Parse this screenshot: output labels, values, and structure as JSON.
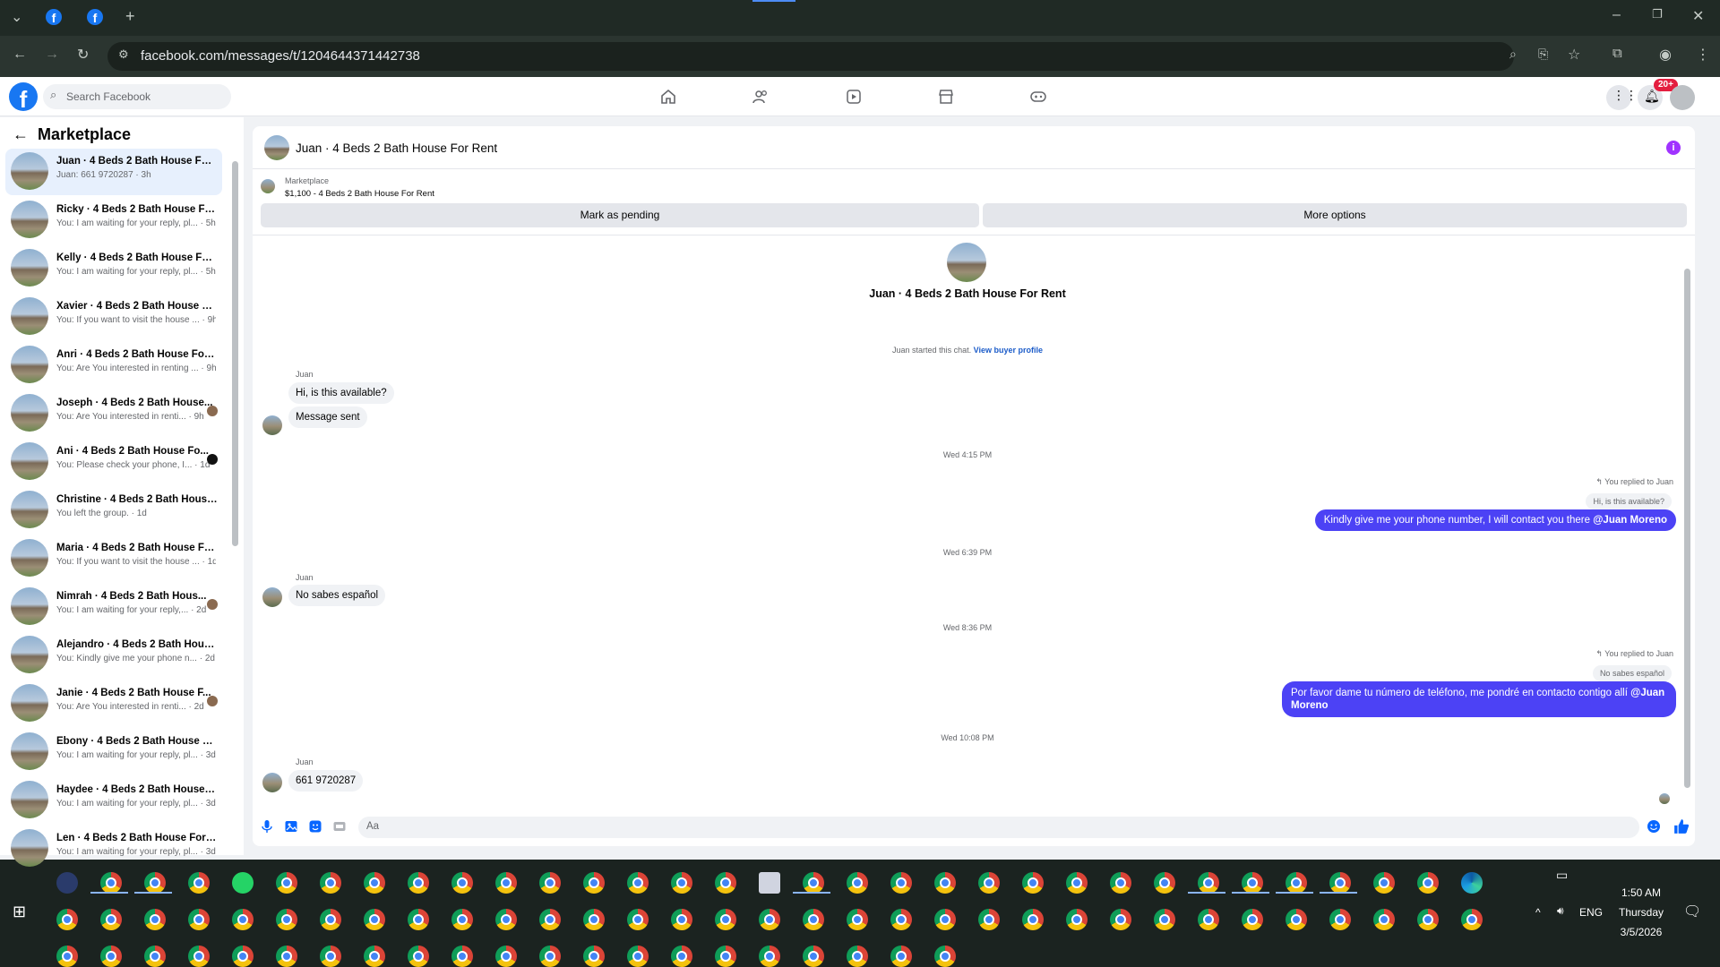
{
  "browser": {
    "url": "facebook.com/messages/t/1204644371442738",
    "new_tab_symbol": "+"
  },
  "fb": {
    "logo": "f",
    "search_placeholder": "Search Facebook",
    "notification_count": "20+",
    "nav_icons": [
      "home-icon",
      "friends-icon",
      "video-icon",
      "marketplace-icon",
      "gaming-icon"
    ]
  },
  "sidebar": {
    "title": "Marketplace",
    "back_symbol": "←",
    "conversations": [
      {
        "name": "Juan · 4 Beds 2 Bath House For ...",
        "snippet": "Juan: 661 9720287 · 3h",
        "active": true
      },
      {
        "name": "Ricky · 4 Beds 2 Bath House For...",
        "snippet": "You: I am waiting for your reply, pl... · 5h"
      },
      {
        "name": "Kelly · 4 Beds 2 Bath House For ...",
        "snippet": "You: I am waiting for your reply, pl... · 5h"
      },
      {
        "name": "Xavier · 4 Beds 2 Bath House Fo...",
        "snippet": "You: If you want to visit the house ... · 9h"
      },
      {
        "name": "Anri · 4 Beds 2 Bath House For ...",
        "snippet": "You: Are You interested in renting ... · 9h"
      },
      {
        "name": "Joseph · 4 Beds 2 Bath House...",
        "snippet": "You: Are You interested in renti... · 9h",
        "dot": true
      },
      {
        "name": "Ani · 4 Beds 2 Bath House Fo...",
        "snippet": "You: Please check your phone, I... · 1d",
        "dot": true
      },
      {
        "name": "Christine · 4 Beds 2 Bath House...",
        "snippet": "You left the group. · 1d"
      },
      {
        "name": "Maria · 4 Beds 2 Bath House Fo...",
        "snippet": "You: If you want to visit the house ... · 1d"
      },
      {
        "name": "Nimrah · 4 Beds 2 Bath Hous...",
        "snippet": "You: I am waiting for your reply,... · 2d",
        "dot": true
      },
      {
        "name": "Alejandro · 4 Beds 2 Bath Hous...",
        "snippet": "You: Kindly give me your phone n... · 2d"
      },
      {
        "name": "Janie · 4 Beds 2 Bath House F...",
        "snippet": "You: Are You interested in renti... · 2d",
        "dot": true
      },
      {
        "name": "Ebony · 4 Beds 2 Bath House Fo...",
        "snippet": "You: I am waiting for your reply, pl... · 3d"
      },
      {
        "name": "Haydee · 4 Beds 2 Bath House F...",
        "snippet": "You: I am waiting for your reply, pl... · 3d"
      },
      {
        "name": "Len · 4 Beds 2 Bath House For R...",
        "snippet": "You: I am waiting for your reply, pl... · 3d"
      }
    ]
  },
  "chat": {
    "title": "Juan · 4 Beds 2 Bath House For Rent",
    "info_symbol": "i",
    "marketplace_label": "Marketplace",
    "listing": "$1,100 - 4 Beds 2 Bath House For Rent",
    "mark_pending": "Mark as pending",
    "more_options": "More options",
    "header_title": "Juan · 4 Beds 2 Bath House For Rent",
    "started_text": "Juan started this chat.",
    "view_profile": "View buyer profile",
    "messages": {
      "sender_juan": "Juan",
      "m1": "Hi, is this available?",
      "m2": "Message sent",
      "t1": "Wed 4:15 PM",
      "replied_1": "You replied to Juan",
      "quote_1": "Hi, is this available?",
      "out_1": "Kindly give me your phone number, I will contact you there",
      "mention": "@Juan Moreno",
      "t2": "Wed 6:39 PM",
      "m3": "No sabes español",
      "t3": "Wed 8:36 PM",
      "replied_2": "You replied to Juan",
      "quote_2": "No sabes español",
      "out_2": "Por favor dame tu número de teléfono, me pondré en contacto contigo allí",
      "t4": "Wed 10:08 PM",
      "m4": "661 9720287"
    },
    "composer_placeholder": "Aa"
  },
  "taskbar": {
    "time": "1:50 AM",
    "day": "Thursday",
    "date": "3/5/2026",
    "lang": "ENG",
    "tray_up": "^"
  }
}
